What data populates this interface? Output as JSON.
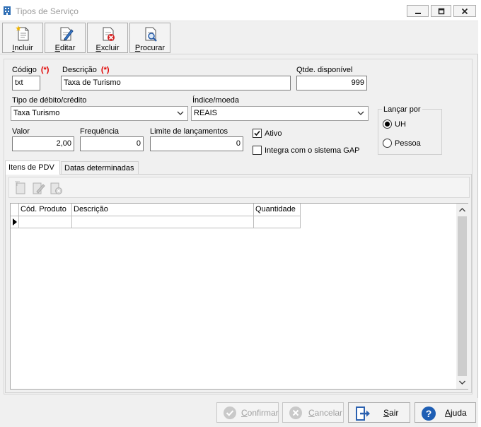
{
  "window": {
    "title": "Tipos de Serviço"
  },
  "toolbar": {
    "incluir": "Incluir",
    "editar": "Editar",
    "excluir": "Excluir",
    "procurar": "Procurar"
  },
  "form": {
    "codigo_label": "Código",
    "descricao_label": "Descrição",
    "required_mark": "(*)",
    "qtde_label": "Qtde. disponível",
    "codigo_value": "txt",
    "descricao_value": "Taxa de Turismo",
    "qtde_value": "999",
    "tipo_label": "Tipo de débito/crédito",
    "tipo_value": "Taxa Turismo",
    "indice_label": "Índice/moeda",
    "indice_value": "REAIS",
    "valor_label": "Valor",
    "valor_value": "2,00",
    "frequencia_label": "Frequência",
    "frequencia_value": "0",
    "limite_label": "Limite de lançamentos",
    "limite_value": "0",
    "ativo_label": "Ativo",
    "ativo_checked": true,
    "integra_label": "Integra com o sistema GAP",
    "integra_checked": false,
    "lancar_label": "Lançar por",
    "lancar_options": [
      "UH",
      "Pessoa"
    ],
    "lancar_selected": "UH"
  },
  "tabs": {
    "itens": "Itens de PDV",
    "datas": "Datas determinadas"
  },
  "grid": {
    "columns": [
      "Cód. Produto",
      "Descrição",
      "Quantidade"
    ]
  },
  "footer": {
    "confirmar": "Confirmar",
    "cancelar": "Cancelar",
    "sair": "Sair",
    "ajuda": "Ajuda"
  },
  "colors": {
    "required": "#e00000",
    "accent_blue": "#1a56a8",
    "disabled_green": "#8fbf8f"
  }
}
